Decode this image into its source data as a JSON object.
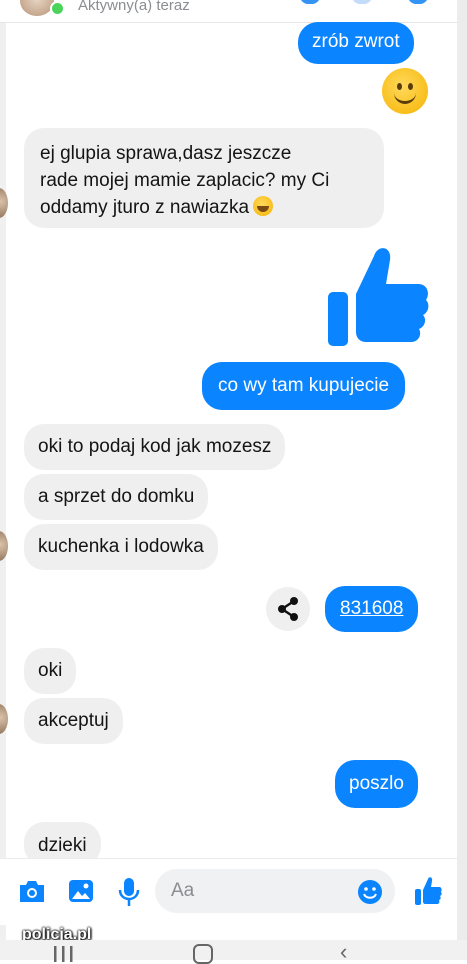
{
  "header": {
    "status": "Aktywny(a) teraz"
  },
  "messages": {
    "m1": "zrób zwrot",
    "m2_l1": "ej glupia sprawa,dasz jeszcze",
    "m2_l2": "rade mojej mamie zaplacic? my Ci",
    "m2_l3": "oddamy jturo z nawiazka",
    "m3": "co wy tam kupujecie",
    "m4": "oki to podaj kod jak mozesz",
    "m5": "a sprzet do domku",
    "m6": "kuchenka i lodowka",
    "m7_code": "831608",
    "m8": "oki",
    "m9": "akceptuj",
    "m10": "poszlo",
    "m11": "dzieki"
  },
  "composer": {
    "placeholder": "Aa",
    "icons": [
      "camera-icon",
      "gallery-icon",
      "microphone-icon",
      "emoji-icon",
      "thumbs-up-icon"
    ]
  },
  "watermark": "policja.pl",
  "colors": {
    "accent": "#0a84ff",
    "incoming_bubble": "#efefef"
  }
}
